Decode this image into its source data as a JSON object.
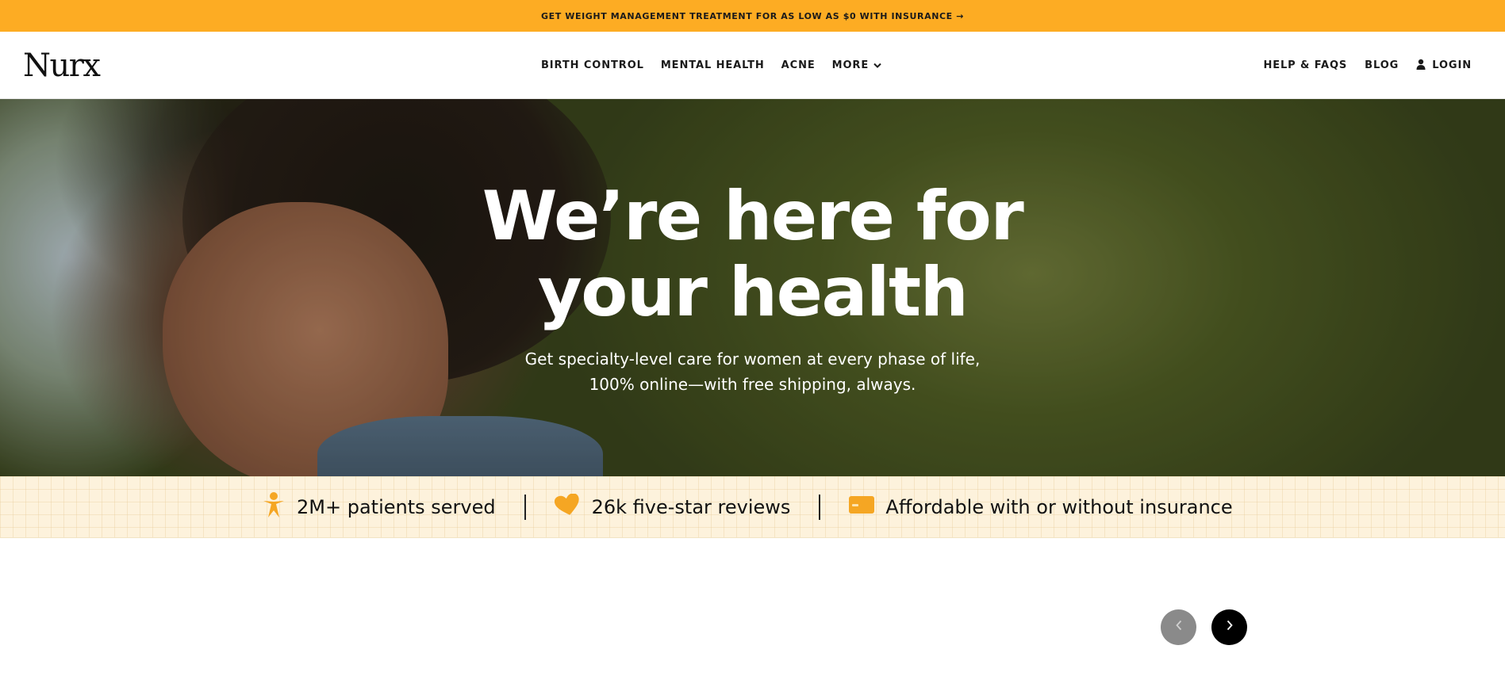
{
  "promo": {
    "text": "GET WEIGHT MANAGEMENT TREATMENT FOR AS LOW AS $0 WITH INSURANCE →"
  },
  "header": {
    "logo": "Nurx",
    "nav": [
      {
        "label": "BIRTH CONTROL"
      },
      {
        "label": "MENTAL HEALTH"
      },
      {
        "label": "ACNE"
      },
      {
        "label": "MORE",
        "icon": "chevron-down-icon"
      }
    ],
    "right_nav": [
      {
        "label": "HELP & FAQS"
      },
      {
        "label": "BLOG"
      },
      {
        "label": "LOGIN",
        "icon": "user-icon"
      }
    ]
  },
  "hero": {
    "title_line1": "We’re here for",
    "title_line2": "your health",
    "subtitle_line1": "Get specialty-level care for women at every phase of life,",
    "subtitle_line2": "100% online—with free shipping, always."
  },
  "stats": [
    {
      "icon": "person-star-icon",
      "text": "2M+ patients served"
    },
    {
      "icon": "heart-icon",
      "text": "26k five-star reviews"
    },
    {
      "icon": "credit-card-icon",
      "text": "Affordable with or without insurance"
    }
  ],
  "carousel": {
    "prev_icon": "chevron-left-icon",
    "next_icon": "chevron-right-icon"
  },
  "colors": {
    "accent": "#fdac23",
    "stats_bg": "#fdf2dc",
    "icon_orange": "#f5a623"
  }
}
